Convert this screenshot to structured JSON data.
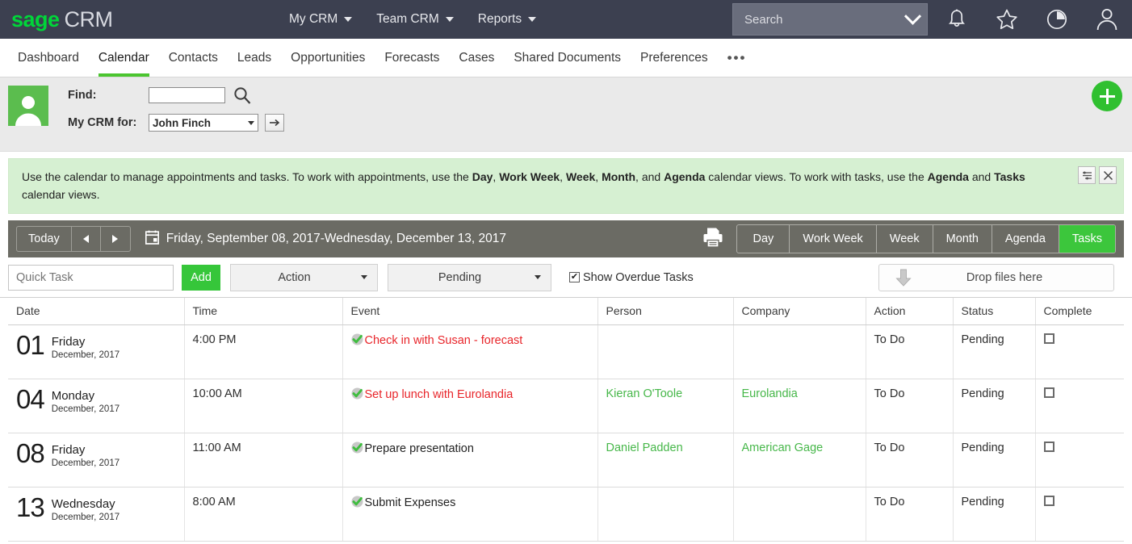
{
  "brand": {
    "name_primary": "sage",
    "name_secondary": "CRM",
    "green": "#00d639"
  },
  "topmenu": [
    {
      "label": "My CRM",
      "icon": "chevron-down-icon"
    },
    {
      "label": "Team CRM",
      "icon": "chevron-down-icon"
    },
    {
      "label": "Reports",
      "icon": "chevron-down-icon"
    }
  ],
  "search": {
    "placeholder": "Search",
    "value": "",
    "icon": "chevron-down-icon"
  },
  "topicons": [
    {
      "name": "bell-icon",
      "label": "Notifications"
    },
    {
      "name": "star-icon",
      "label": "Favorites"
    },
    {
      "name": "clock-icon",
      "label": "Recent"
    },
    {
      "name": "user-icon",
      "label": "User Profile"
    }
  ],
  "modnav": {
    "items": [
      {
        "label": "Dashboard",
        "active": false
      },
      {
        "label": "Calendar",
        "active": true
      },
      {
        "label": "Contacts",
        "active": false
      },
      {
        "label": "Leads",
        "active": false
      },
      {
        "label": "Opportunities",
        "active": false
      },
      {
        "label": "Forecasts",
        "active": false
      },
      {
        "label": "Cases",
        "active": false
      },
      {
        "label": "Shared Documents",
        "active": false
      },
      {
        "label": "Preferences",
        "active": false
      }
    ],
    "more_label": "•••"
  },
  "findpanel": {
    "find_label": "Find:",
    "find_value": "",
    "crm_for_label": "My CRM for:",
    "crm_for_value": "John Finch",
    "search_icon": "magnifier-icon",
    "go_icon": "arrow-right-icon",
    "avatar_icon": "person-avatar-icon"
  },
  "fab": {
    "name": "add-new-button",
    "label": "+"
  },
  "help_banner": {
    "text_parts": [
      {
        "t": "Use the calendar to manage appointments and tasks. To work with appointments, use the ",
        "b": false
      },
      {
        "t": "Day",
        "b": true
      },
      {
        "t": ", ",
        "b": false
      },
      {
        "t": "Work Week",
        "b": true
      },
      {
        "t": ", ",
        "b": false
      },
      {
        "t": "Week",
        "b": true
      },
      {
        "t": ", ",
        "b": false
      },
      {
        "t": "Month",
        "b": true
      },
      {
        "t": ", and ",
        "b": false
      },
      {
        "t": "Agenda",
        "b": true
      },
      {
        "t": " calendar views. To work with tasks, use the ",
        "b": false
      },
      {
        "t": "Agenda",
        "b": true
      },
      {
        "t": " and ",
        "b": false
      },
      {
        "t": "Tasks",
        "b": true
      },
      {
        "t": " calendar views.",
        "b": false
      }
    ],
    "buttons": [
      {
        "name": "banner-options-icon",
        "label": "options"
      },
      {
        "name": "close-icon",
        "label": "✕"
      }
    ],
    "background": "#d6f0d2"
  },
  "toolbar": {
    "today_label": "Today",
    "prev_icon": "arrow-left-icon",
    "next_icon": "arrow-right-icon",
    "calendar_icon": "calendar-icon",
    "date_range": "Friday, September 08, 2017-Wednesday, December 13, 2017",
    "print_icon": "printer-icon",
    "views": [
      {
        "label": "Day",
        "active": false
      },
      {
        "label": "Work Week",
        "active": false
      },
      {
        "label": "Week",
        "active": false
      },
      {
        "label": "Month",
        "active": false
      },
      {
        "label": "Agenda",
        "active": false
      },
      {
        "label": "Tasks",
        "active": true
      }
    ],
    "active_color": "#3cc63c"
  },
  "filterbar": {
    "quick_task_placeholder": "Quick Task",
    "quick_task_value": "",
    "add_label": "Add",
    "action_label": "Action",
    "status_label": "Pending",
    "show_overdue_label": "Show Overdue Tasks",
    "show_overdue_checked": true,
    "dropzone_label": "Drop files here",
    "dropzone_icon": "download-arrow-icon"
  },
  "table": {
    "columns": [
      "Date",
      "Time",
      "Event",
      "Person",
      "Company",
      "Action",
      "Status",
      "Complete"
    ],
    "rows": [
      {
        "day_number": "01",
        "day_name": "Friday",
        "day_date": "December, 2017",
        "time": "4:00 PM",
        "event": "Check in with Susan - forecast",
        "event_overdue": true,
        "person": "",
        "company": "",
        "action": "To Do",
        "status": "Pending",
        "complete_checked": false
      },
      {
        "day_number": "04",
        "day_name": "Monday",
        "day_date": "December, 2017",
        "time": "10:00 AM",
        "event": "Set up lunch with Eurolandia",
        "event_overdue": true,
        "person": "Kieran O'Toole",
        "company": "Eurolandia",
        "action": "To Do",
        "status": "Pending",
        "complete_checked": false
      },
      {
        "day_number": "08",
        "day_name": "Friday",
        "day_date": "December, 2017",
        "time": "11:00 AM",
        "event": "Prepare presentation",
        "event_overdue": false,
        "person": "Daniel Padden",
        "company": "American Gage",
        "action": "To Do",
        "status": "Pending",
        "complete_checked": false
      },
      {
        "day_number": "13",
        "day_name": "Wednesday",
        "day_date": "December, 2017",
        "time": "8:00 AM",
        "event": "Submit Expenses",
        "event_overdue": false,
        "person": "",
        "company": "",
        "action": "To Do",
        "status": "Pending",
        "complete_checked": false
      }
    ],
    "overdue_color": "#e8252a",
    "link_color": "#46b749",
    "tick_icon": "green-check-icon"
  }
}
